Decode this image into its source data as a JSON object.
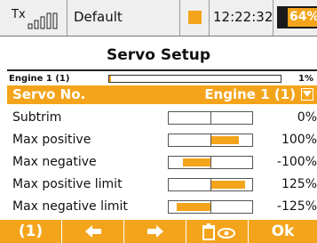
{
  "status_bar": {
    "tx_label": "Tx",
    "signal_icon": "signal-bars-icon",
    "model_name": "Default",
    "recording_indicator_color": "#f4a41b",
    "clock": "12:22:32",
    "battery_percent": "64%",
    "battery_level": 0.64
  },
  "title": "Servo Setup",
  "engine_readout": {
    "label": "Engine 1 (1)",
    "value": "1%",
    "level": 0.01
  },
  "servo_select": {
    "label": "Servo No.",
    "value": "Engine 1 (1)",
    "dropdown_icon": "chevron-down-icon"
  },
  "params": [
    {
      "label": "Subtrim",
      "value": "0%",
      "level": 0
    },
    {
      "label": "Max positive",
      "value": "100%",
      "level": 100
    },
    {
      "label": "Max negative",
      "value": "-100%",
      "level": -100
    },
    {
      "label": "Max positive limit",
      "value": "125%",
      "level": 125
    },
    {
      "label": "Max negative limit",
      "value": "-125%",
      "level": -125
    }
  ],
  "toolbar": {
    "buttons": [
      {
        "label": "(1)",
        "icon": ""
      },
      {
        "label": "",
        "icon": "arrow-left-icon"
      },
      {
        "label": "",
        "icon": "arrow-right-icon"
      },
      {
        "label": "",
        "icon": "trash-eye-icon"
      },
      {
        "label": "Ok",
        "icon": ""
      }
    ]
  },
  "colors": {
    "accent": "#f4a41b",
    "status_bg": "#efefef"
  }
}
